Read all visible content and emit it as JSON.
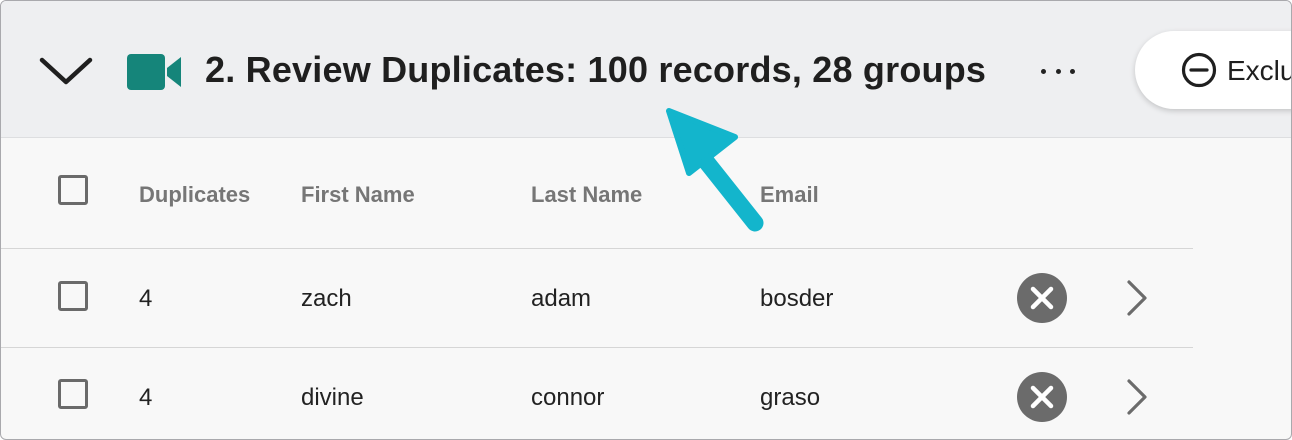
{
  "header": {
    "title": "2. Review Duplicates: 100 records, 28 groups",
    "exclude_label": "Exclu",
    "icons": {
      "collapse": "chevron-down-icon",
      "record": "video-camera-icon",
      "more": "ellipsis-icon",
      "exclude": "minus-circle-icon"
    },
    "icon_color": "#15857a"
  },
  "table": {
    "columns": [
      "Duplicates",
      "First Name",
      "Last Name",
      "Email"
    ],
    "rows": [
      {
        "duplicates": "4",
        "first_name": "zach",
        "last_name": "adam",
        "email": "bosder"
      },
      {
        "duplicates": "4",
        "first_name": "divine",
        "last_name": "connor",
        "email": "graso"
      }
    ],
    "row_icons": {
      "remove": "close-circle-icon",
      "open": "chevron-right-icon"
    }
  },
  "annotation": {
    "arrow_color": "#13b5cc"
  }
}
